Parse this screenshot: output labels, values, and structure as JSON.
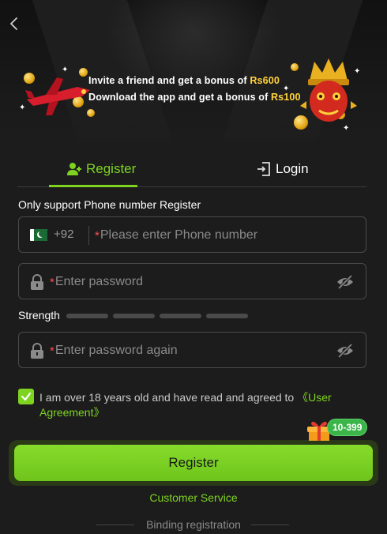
{
  "header": {
    "back_icon": "chevron-left-icon",
    "promo": {
      "line1_text": "Invite a friend and get a bonus of ",
      "line1_amount": "Rs600",
      "line2_text": "Download the app and get a bonus of ",
      "line2_amount": "Rs100"
    }
  },
  "tabs": [
    {
      "label": "Register",
      "icon": "add-user-icon",
      "active": true
    },
    {
      "label": "Login",
      "icon": "login-door-icon",
      "active": false
    }
  ],
  "form": {
    "notice": "Only support Phone number Register",
    "phone": {
      "country_flag": "pakistan-flag-icon",
      "country_code": "+92",
      "required_mark": "*",
      "placeholder": "Please enter Phone number",
      "value": ""
    },
    "password": {
      "required_mark": "*",
      "placeholder": "Enter password",
      "value": ""
    },
    "strength": {
      "label": "Strength",
      "level": 0,
      "segments": 4
    },
    "password_again": {
      "required_mark": "*",
      "placeholder": "Enter password again",
      "value": ""
    },
    "agreement": {
      "checked": true,
      "text": "I am over 18 years old and have read and agreed to ",
      "link": "《User Agreement》"
    }
  },
  "gift_badge": "10-399",
  "register_button": "Register",
  "customer_service": "Customer Service",
  "binding_text": "Binding registration",
  "colors": {
    "accent": "#7ed321",
    "background": "#1c1c1c",
    "required": "#ff4d4d",
    "bonus": "#ffd23c"
  }
}
